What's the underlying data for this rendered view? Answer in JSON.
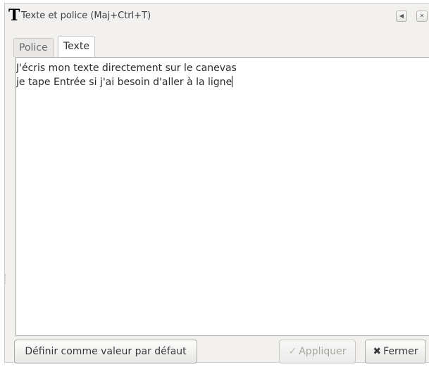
{
  "window": {
    "title_glyph": "T",
    "title": "Texte et police (Maj+Ctrl+T)",
    "buttons": [
      {
        "icon": "arrow-left-icon",
        "glyph": "◀"
      },
      {
        "icon": "close-icon",
        "glyph": "✕"
      }
    ]
  },
  "tabs": [
    {
      "label": "Police",
      "active": false
    },
    {
      "label": "Texte",
      "active": true
    }
  ],
  "editor": {
    "lines": [
      "J'écris mon texte directement sur le canevas",
      "je tape Entrée si j'ai besoin d'aller à la ligne"
    ]
  },
  "actions": {
    "default_label": "Définir comme valeur par défaut",
    "apply_label": "Appliquer",
    "apply_icon": "check-icon",
    "apply_glyph": "✓",
    "apply_enabled": false,
    "close_label": "Fermer",
    "close_icon": "close-icon",
    "close_glyph": "✖"
  }
}
